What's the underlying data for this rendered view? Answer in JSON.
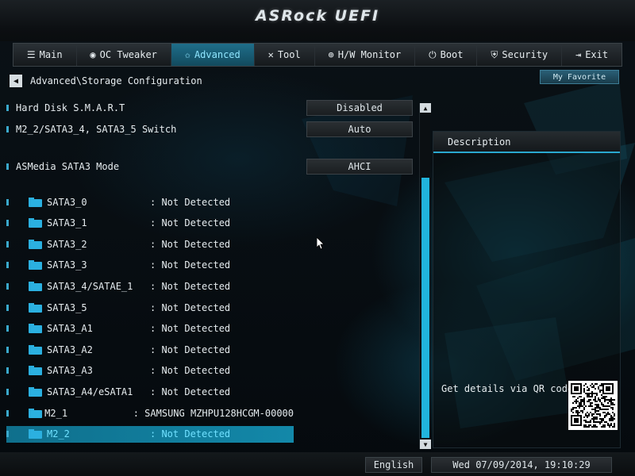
{
  "app": {
    "logo_text": "ASRock UEFI"
  },
  "menu": [
    {
      "icon": "list-icon",
      "glyph": "☰",
      "label": "Main"
    },
    {
      "icon": "gauge-icon",
      "glyph": "◉",
      "label": "OC Tweaker"
    },
    {
      "icon": "star-icon",
      "glyph": "✩",
      "label": "Advanced"
    },
    {
      "icon": "tools-icon",
      "glyph": "✕",
      "label": "Tool"
    },
    {
      "icon": "monitor-icon",
      "glyph": "⊕",
      "label": "H/W Monitor"
    },
    {
      "icon": "power-icon",
      "glyph": "⏻",
      "label": "Boot"
    },
    {
      "icon": "shield-icon",
      "glyph": "⛨",
      "label": "Security"
    },
    {
      "icon": "exit-icon",
      "glyph": "⇥",
      "label": "Exit"
    }
  ],
  "active_menu": "Advanced",
  "breadcrumb": "Advanced\\Storage Configuration",
  "my_favorite": "My Favorite",
  "settings": [
    {
      "label": "Hard Disk S.M.A.R.T",
      "value": "Disabled"
    },
    {
      "label": "M2_2/SATA3_4, SATA3_5 Switch",
      "value": "Auto"
    },
    {
      "label": "ASMedia SATA3 Mode",
      "value": "AHCI"
    }
  ],
  "devices": [
    {
      "name": "SATA3_0",
      "status": ": Not Detected"
    },
    {
      "name": "SATA3_1",
      "status": ": Not Detected"
    },
    {
      "name": "SATA3_2",
      "status": ": Not Detected"
    },
    {
      "name": "SATA3_3",
      "status": ": Not Detected"
    },
    {
      "name": "SATA3_4/SATAE_1",
      "status": ": Not Detected"
    },
    {
      "name": "SATA3_5",
      "status": ": Not Detected"
    },
    {
      "name": "SATA3_A1",
      "status": ": Not Detected"
    },
    {
      "name": "SATA3_A2",
      "status": ": Not Detected"
    },
    {
      "name": "SATA3_A3",
      "status": ": Not Detected"
    },
    {
      "name": "SATA3_A4/eSATA1",
      "status": ": Not Detected"
    },
    {
      "name": "M2_1",
      "status": ": SAMSUNG MZHPU128HCGM-00000"
    },
    {
      "name": "M2_2",
      "status": ": Not Detected"
    }
  ],
  "selected_device": "M2_2",
  "description": {
    "title": "Description",
    "qr_text": "Get details via QR code"
  },
  "footer": {
    "language": "English",
    "datetime": "Wed 07/09/2014, 19:10:29"
  },
  "colors": {
    "accent": "#21b4dc",
    "selected_text": "#6fe0ff"
  }
}
